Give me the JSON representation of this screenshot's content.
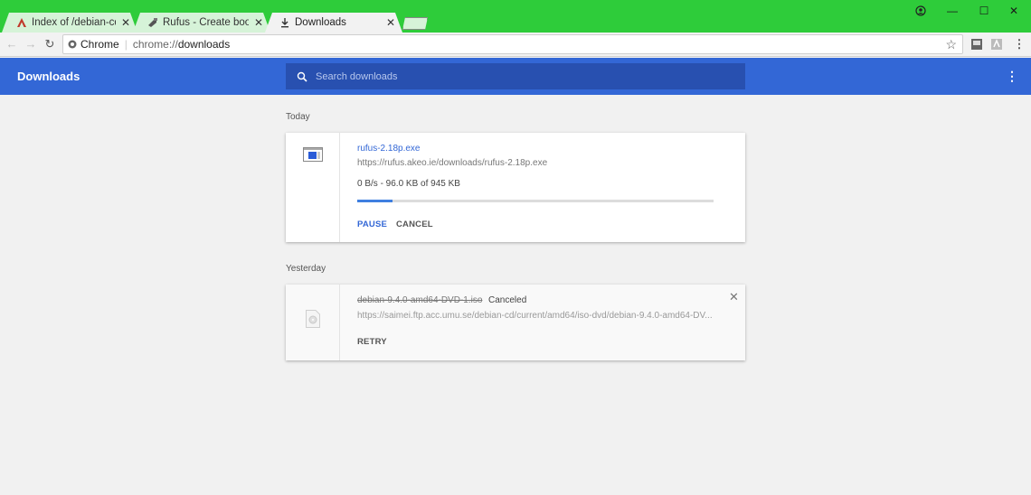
{
  "colors": {
    "titlebar": "#2ecc3a",
    "accent": "#3367d6",
    "progress": "#3f7fe0"
  },
  "tabs": [
    {
      "title": "Index of /debian-cd/curr",
      "favicon": "debian-a-icon",
      "active": false
    },
    {
      "title": "Rufus - Create bootable U",
      "favicon": "rufus-icon",
      "active": false
    },
    {
      "title": "Downloads",
      "favicon": "download-icon",
      "active": true
    }
  ],
  "toolbar": {
    "omnibox_label": "Chrome",
    "url_scheme": "chrome://",
    "url_path": "downloads"
  },
  "downloads_header": {
    "title": "Downloads",
    "search_placeholder": "Search downloads"
  },
  "sections": [
    {
      "label": "Today",
      "items": [
        {
          "filename": "rufus-2.18p.exe",
          "url": "https://rufus.akeo.ie/downloads/rufus-2.18p.exe",
          "status": "0 B/s - 96.0 KB of 945 KB",
          "progress_fraction": 0.1,
          "actions": [
            "PAUSE",
            "CANCEL"
          ]
        }
      ]
    },
    {
      "label": "Yesterday",
      "items": [
        {
          "filename": "debian-9.4.0-amd64-DVD-1.iso",
          "state": "Canceled",
          "url": "https://saimei.ftp.acc.umu.se/debian-cd/current/amd64/iso-dvd/debian-9.4.0-amd64-DV...",
          "actions": [
            "RETRY"
          ]
        }
      ]
    }
  ]
}
